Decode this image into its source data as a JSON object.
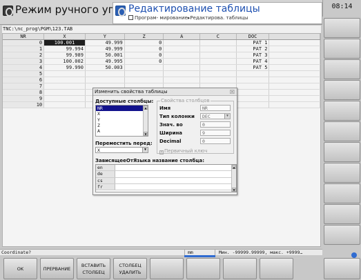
{
  "header": {
    "operating_mode": "Режим ручного упра...",
    "programming_mode": "Редактирование таблицы",
    "breadcrumb": [
      "Програм- мирование",
      "Редактирова. таблицы"
    ],
    "clock": "08:14"
  },
  "path": "TNC:\\nc_prog\\PGM\\123.TAB",
  "table": {
    "columns": [
      "NR",
      "X",
      "Y",
      "Z",
      "A",
      "C",
      "DOC",
      ""
    ],
    "rows": [
      {
        "nr": "0",
        "x": "100.001",
        "y": "49.999",
        "z": "0",
        "a": "",
        "c": "",
        "doc": "PAT 1"
      },
      {
        "nr": "1",
        "x": "99.994",
        "y": "49.999",
        "z": "0",
        "a": "",
        "c": "",
        "doc": "PAT 2"
      },
      {
        "nr": "2",
        "x": "99.989",
        "y": "50.001",
        "z": "0",
        "a": "",
        "c": "",
        "doc": "PAT 3"
      },
      {
        "nr": "3",
        "x": "100.002",
        "y": "49.995",
        "z": "0",
        "a": "",
        "c": "",
        "doc": "PAT 4"
      },
      {
        "nr": "4",
        "x": "99.990",
        "y": "50.003",
        "z": "",
        "a": "",
        "c": "",
        "doc": "PAT 5"
      },
      {
        "nr": "5",
        "x": "",
        "y": "",
        "z": "",
        "a": "",
        "c": "",
        "doc": ""
      },
      {
        "nr": "6",
        "x": "",
        "y": "",
        "z": "",
        "a": "",
        "c": "",
        "doc": ""
      },
      {
        "nr": "7",
        "x": "",
        "y": "",
        "z": "",
        "a": "",
        "c": "",
        "doc": ""
      },
      {
        "nr": "8",
        "x": "",
        "y": "",
        "z": "",
        "a": "",
        "c": "",
        "doc": ""
      },
      {
        "nr": "9",
        "x": "",
        "y": "",
        "z": "",
        "a": "",
        "c": "",
        "doc": ""
      },
      {
        "nr": "10",
        "x": "",
        "y": "",
        "z": "",
        "a": "",
        "c": "",
        "doc": ""
      }
    ]
  },
  "dialog": {
    "title": "Изменить свойства таблицы",
    "close": "☒",
    "available_label": "Доступные столбцы:",
    "available": [
      "NR",
      "X",
      "Y",
      "Z",
      "A"
    ],
    "selected_index": 0,
    "move_label": "Переместить перед:",
    "move_value": "X",
    "props_legend": "Свойства столбцов",
    "props": [
      {
        "label": "Имя",
        "value": "NR"
      },
      {
        "label": "Тип колонки",
        "value": "DEC"
      },
      {
        "label": "Знач. во",
        "value": "0"
      },
      {
        "label": "Ширина",
        "value": "9"
      },
      {
        "label": "Decimal",
        "value": "0"
      }
    ],
    "primary_key": "Первичный ключ",
    "lang_label": "ЗависящееОтЯзыка название столбца:",
    "langs": [
      "en",
      "de",
      "cs",
      "fr"
    ]
  },
  "status": {
    "coordinate": "Coordinate?",
    "mid": "mm",
    "range": "Мин. -99999.99999, макс. +9999…"
  },
  "softkeys": {
    "ok": "OK",
    "cancel": "ПРЕРВАНИЕ",
    "insert_l1": "ВСТАВИТЬ",
    "insert_l2": "СТОЛБЕЦ",
    "delete_l1": "СТОЛБЕЦ",
    "delete_l2": "УДАЛИТЬ"
  },
  "colors": {
    "accent": "#2f6bd1",
    "selection": "#12128c"
  }
}
